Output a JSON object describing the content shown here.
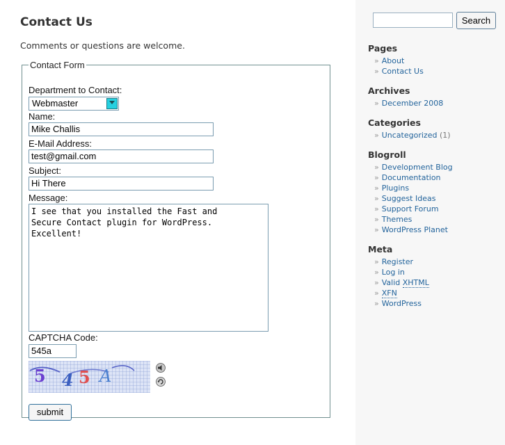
{
  "page": {
    "title": "Contact Us",
    "intro": "Comments or questions are welcome."
  },
  "form": {
    "legend": "Contact Form",
    "department_label": "Department to Contact:",
    "department_value": "Webmaster",
    "name_label": "Name:",
    "name_value": "Mike Challis",
    "email_label": "E-Mail Address:",
    "email_value": "test@gmail.com",
    "subject_label": "Subject:",
    "subject_value": "Hi There",
    "message_label": "Message:",
    "message_value": "I see that you installed the Fast and\nSecure Contact plugin for WordPress.\nExcellent!",
    "captcha_label": "CAPTCHA Code:",
    "captcha_value": "545a",
    "captcha_chars": [
      "5",
      "4",
      "5",
      "A"
    ],
    "captcha_colors": [
      "#6b3fd0",
      "#3b5fc0",
      "#e05050",
      "#4a7fd0"
    ],
    "submit_label": "submit"
  },
  "sidebar": {
    "search_button": "Search",
    "search_placeholder": "",
    "pages": {
      "title": "Pages",
      "items": [
        "About",
        "Contact Us"
      ]
    },
    "archives": {
      "title": "Archives",
      "items": [
        "December 2008"
      ]
    },
    "categories": {
      "title": "Categories",
      "items": [
        {
          "label": "Uncategorized",
          "count": "(1)"
        }
      ]
    },
    "blogroll": {
      "title": "Blogroll",
      "items": [
        "Development Blog",
        "Documentation",
        "Plugins",
        "Suggest Ideas",
        "Support Forum",
        "Themes",
        "WordPress Planet"
      ]
    },
    "meta": {
      "title": "Meta",
      "register": "Register",
      "login": "Log in",
      "valid_prefix": "Valid",
      "xhtml": "XHTML",
      "xfn": "XFN",
      "wordpress": "WordPress"
    }
  },
  "colors": {
    "link": "#22639b",
    "sidebar_bg": "#f7f7f7",
    "select_arrow": "#26d0e0"
  }
}
